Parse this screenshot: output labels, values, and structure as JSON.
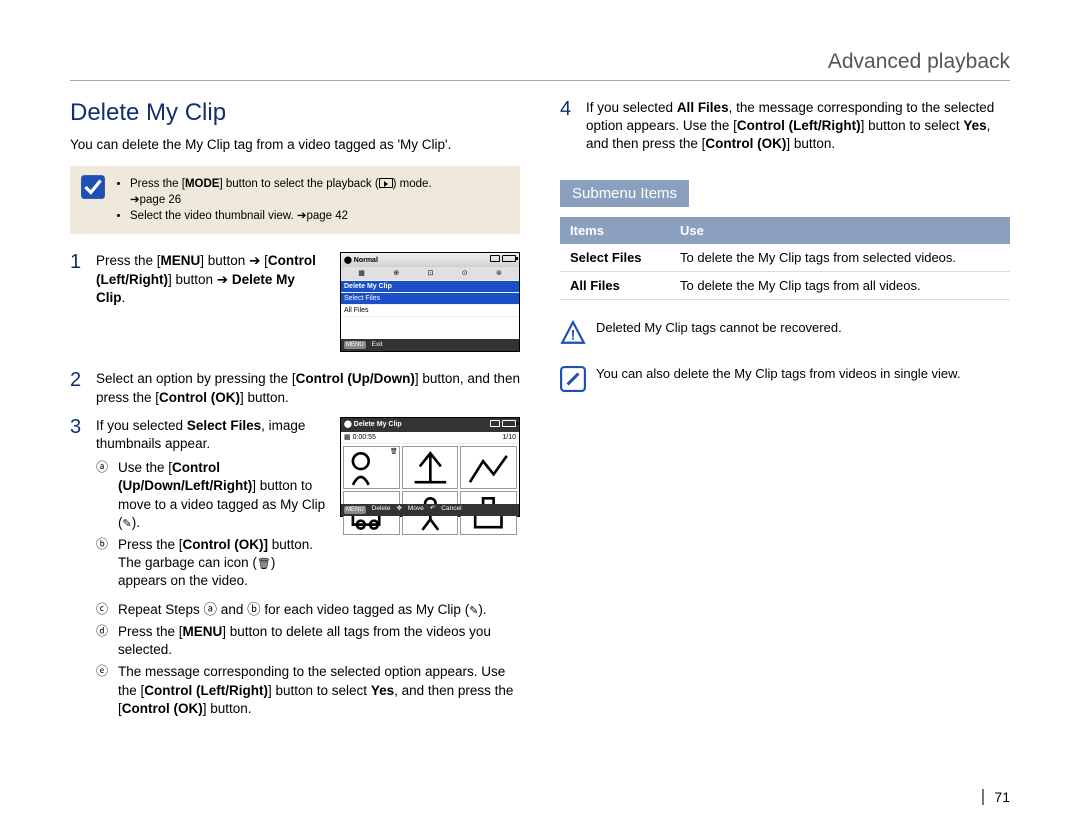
{
  "chapter": "Advanced playback",
  "page_number": "71",
  "section_title": "Delete My Clip",
  "intro": "You can delete the My Clip tag from a video tagged as 'My Clip'.",
  "note1": {
    "bullet1_a": "Press the [",
    "bullet1_b": "MODE",
    "bullet1_c": "] button to select the playback (",
    "bullet1_d": ") mode.",
    "bullet1_ref": "➔page 26",
    "bullet2": "Select the video thumbnail view. ➔page 42"
  },
  "steps": {
    "s1": {
      "num": "1",
      "a": "Press the [",
      "b": "MENU",
      "c": "] button ➔ [",
      "d": "Control (Left/Right)",
      "e": "] button ➔ ",
      "f": "Delete My Clip",
      "g": "."
    },
    "s2": {
      "num": "2",
      "a": "Select an option by pressing the [",
      "b": "Control (Up/Down)",
      "c": "] button, and then press the [",
      "d": "Control (OK)",
      "e": "] button."
    },
    "s3": {
      "num": "3",
      "a": "If you selected ",
      "b": "Select Files",
      "c": ", image thumbnails appear."
    },
    "s3a": {
      "m": "ⓐ",
      "a": "Use the [",
      "b": "Control (Up/Down/Left/Right)",
      "c": "] button to move to a video tagged as My Clip (",
      "d": ")."
    },
    "s3b": {
      "m": "ⓑ",
      "a": "Press the [",
      "b": "Control (OK)]",
      "c": " button. The garbage can icon (",
      "d": ") appears on the video."
    },
    "s3c": {
      "m": "ⓒ",
      "a": "Repeat Steps ⓐ and ⓑ for each video tagged as My Clip (",
      "b": ")."
    },
    "s3d": {
      "m": "ⓓ",
      "a": "Press the [",
      "b": "MENU",
      "c": "] button to delete all tags from the videos you selected."
    },
    "s3e": {
      "m": "ⓔ",
      "a": "The message corresponding to the selected option appears. Use the [",
      "b": "Control (Left/Right)",
      "c": "] button to select ",
      "d": "Yes",
      "e": ", and then press the [",
      "f": "Control (OK)",
      "g": "] button."
    },
    "s4": {
      "num": "4",
      "a": "If you selected ",
      "b": "All Files",
      "c": ", the message corresponding to the selected option appears. Use the [",
      "d": "Control (Left/Right)",
      "e": "] button to select ",
      "f": "Yes",
      "g": ", and then press the [",
      "h": "Control (OK)",
      "i": "] button."
    }
  },
  "submenu": {
    "header": "Submenu Items",
    "th1": "Items",
    "th2": "Use",
    "r1c1": "Select Files",
    "r1c2": "To delete the My Clip tags from selected videos.",
    "r2c1": "All Files",
    "r2c2": "To delete the My Clip tags from all videos."
  },
  "warn_msg": "Deleted My Clip tags cannot be recovered.",
  "info_msg": "You can also delete the My Clip tags from videos in single view.",
  "lcd1": {
    "mode": "Normal",
    "hdr": "Delete My Clip",
    "opt1": "Select Files",
    "opt2": "All Files",
    "exit": "Exit",
    "menu": "MENU"
  },
  "lcd2": {
    "hdr": "Delete My Clip",
    "timer": "0:00:55",
    "counter": "1/10",
    "menu": "MENU",
    "del": "Delete",
    "move": "Move",
    "cancel": "Cancel"
  }
}
